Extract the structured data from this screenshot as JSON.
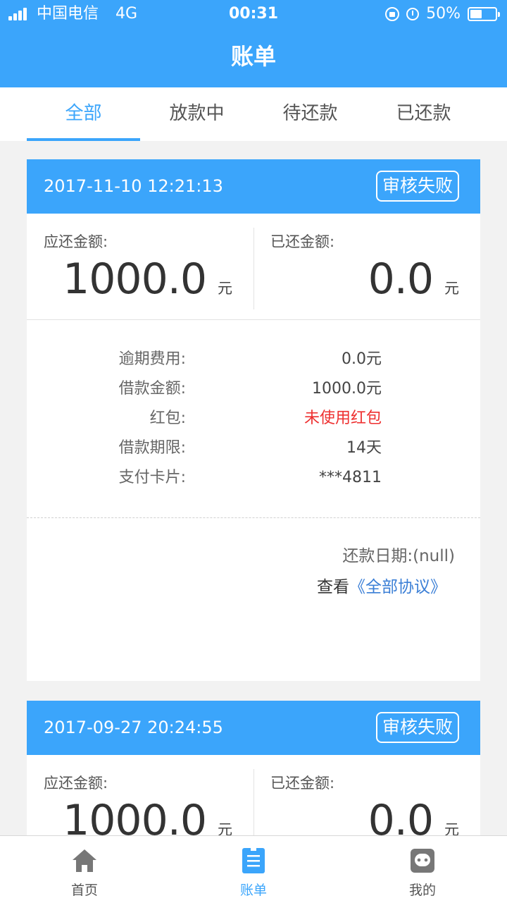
{
  "status_bar": {
    "carrier": "中国电信",
    "network": "4G",
    "time": "00:31",
    "battery": "50%"
  },
  "header": {
    "title": "账单"
  },
  "tabs": [
    {
      "label": "全部",
      "active": true
    },
    {
      "label": "放款中",
      "active": false
    },
    {
      "label": "待还款",
      "active": false
    },
    {
      "label": "已还款",
      "active": false
    }
  ],
  "bills": [
    {
      "datetime": "2017-11-10 12:21:13",
      "status": "审核失败",
      "due_label": "应还金额:",
      "due_amount": "1000.0",
      "paid_label": "已还金额:",
      "paid_amount": "0.0",
      "unit": "元",
      "details": [
        {
          "label": "逾期费用:",
          "value": "0.0元"
        },
        {
          "label": "借款金额:",
          "value": "1000.0元"
        },
        {
          "label": "红包:",
          "value": "未使用红包"
        },
        {
          "label": "借款期限:",
          "value": "14天"
        },
        {
          "label": "支付卡片:",
          "value": "***4811"
        }
      ],
      "repay_date": "还款日期:(null)",
      "view_prefix": "查看",
      "agreement_link": "《全部协议》"
    },
    {
      "datetime": "2017-09-27 20:24:55",
      "status": "审核失败",
      "due_label": "应还金额:",
      "due_amount": "1000.0",
      "paid_label": "已还金额:",
      "paid_amount": "0.0",
      "unit": "元"
    }
  ],
  "bottom_nav": [
    {
      "label": "首页",
      "icon": "home-icon",
      "active": false
    },
    {
      "label": "账单",
      "icon": "bill-icon",
      "active": true
    },
    {
      "label": "我的",
      "icon": "profile-icon",
      "active": false
    }
  ],
  "colors": {
    "primary": "#3ba5fb",
    "link": "#3b7fd6",
    "highlight_red": "#ee3030",
    "icon_gray": "#777777"
  }
}
